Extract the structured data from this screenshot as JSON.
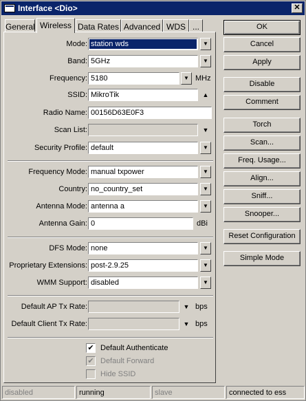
{
  "window": {
    "title": "Interface <Dio>",
    "close_glyph": "✕"
  },
  "tabs": [
    "General",
    "Wireless",
    "Data Rates",
    "Advanced",
    "WDS",
    "..."
  ],
  "active_tab": "Wireless",
  "form": {
    "mode": {
      "label": "Mode:",
      "value": "station wds"
    },
    "band": {
      "label": "Band:",
      "value": "5GHz"
    },
    "frequency": {
      "label": "Frequency:",
      "value": "5180",
      "unit": "MHz"
    },
    "ssid": {
      "label": "SSID:",
      "value": "MikroTik"
    },
    "radio_name": {
      "label": "Radio Name:",
      "value": "00156D63E0F3"
    },
    "scan_list": {
      "label": "Scan List:",
      "value": ""
    },
    "security_profile": {
      "label": "Security Profile:",
      "value": "default"
    },
    "frequency_mode": {
      "label": "Frequency Mode:",
      "value": "manual txpower"
    },
    "country": {
      "label": "Country:",
      "value": "no_country_set"
    },
    "antenna_mode": {
      "label": "Antenna Mode:",
      "value": "antenna a"
    },
    "antenna_gain": {
      "label": "Antenna Gain:",
      "value": "0",
      "unit": "dBi"
    },
    "dfs_mode": {
      "label": "DFS Mode:",
      "value": "none"
    },
    "proprietary_extensions": {
      "label": "Proprietary Extensions:",
      "value": "post-2.9.25"
    },
    "wmm_support": {
      "label": "WMM Support:",
      "value": "disabled"
    },
    "default_ap_tx_rate": {
      "label": "Default AP Tx Rate:",
      "value": "",
      "unit": "bps"
    },
    "default_client_tx_rate": {
      "label": "Default Client Tx Rate:",
      "value": "",
      "unit": "bps"
    },
    "default_authenticate": {
      "label": "Default Authenticate",
      "checked": true
    },
    "default_forward": {
      "label": "Default Forward",
      "checked": true
    },
    "hide_ssid": {
      "label": "Hide SSID",
      "checked": false
    }
  },
  "glyphs": {
    "dropdown": "▼",
    "up": "▲",
    "check": "✔"
  },
  "buttons": {
    "ok": "OK",
    "cancel": "Cancel",
    "apply": "Apply",
    "disable": "Disable",
    "comment": "Comment",
    "torch": "Torch",
    "scan": "Scan...",
    "freq_usage": "Freq. Usage...",
    "align": "Align...",
    "sniff": "Sniff...",
    "snooper": "Snooper...",
    "reset_configuration": "Reset Configuration",
    "simple_mode": "Simple Mode"
  },
  "status": [
    "disabled",
    "running",
    "slave",
    "connected to ess"
  ]
}
